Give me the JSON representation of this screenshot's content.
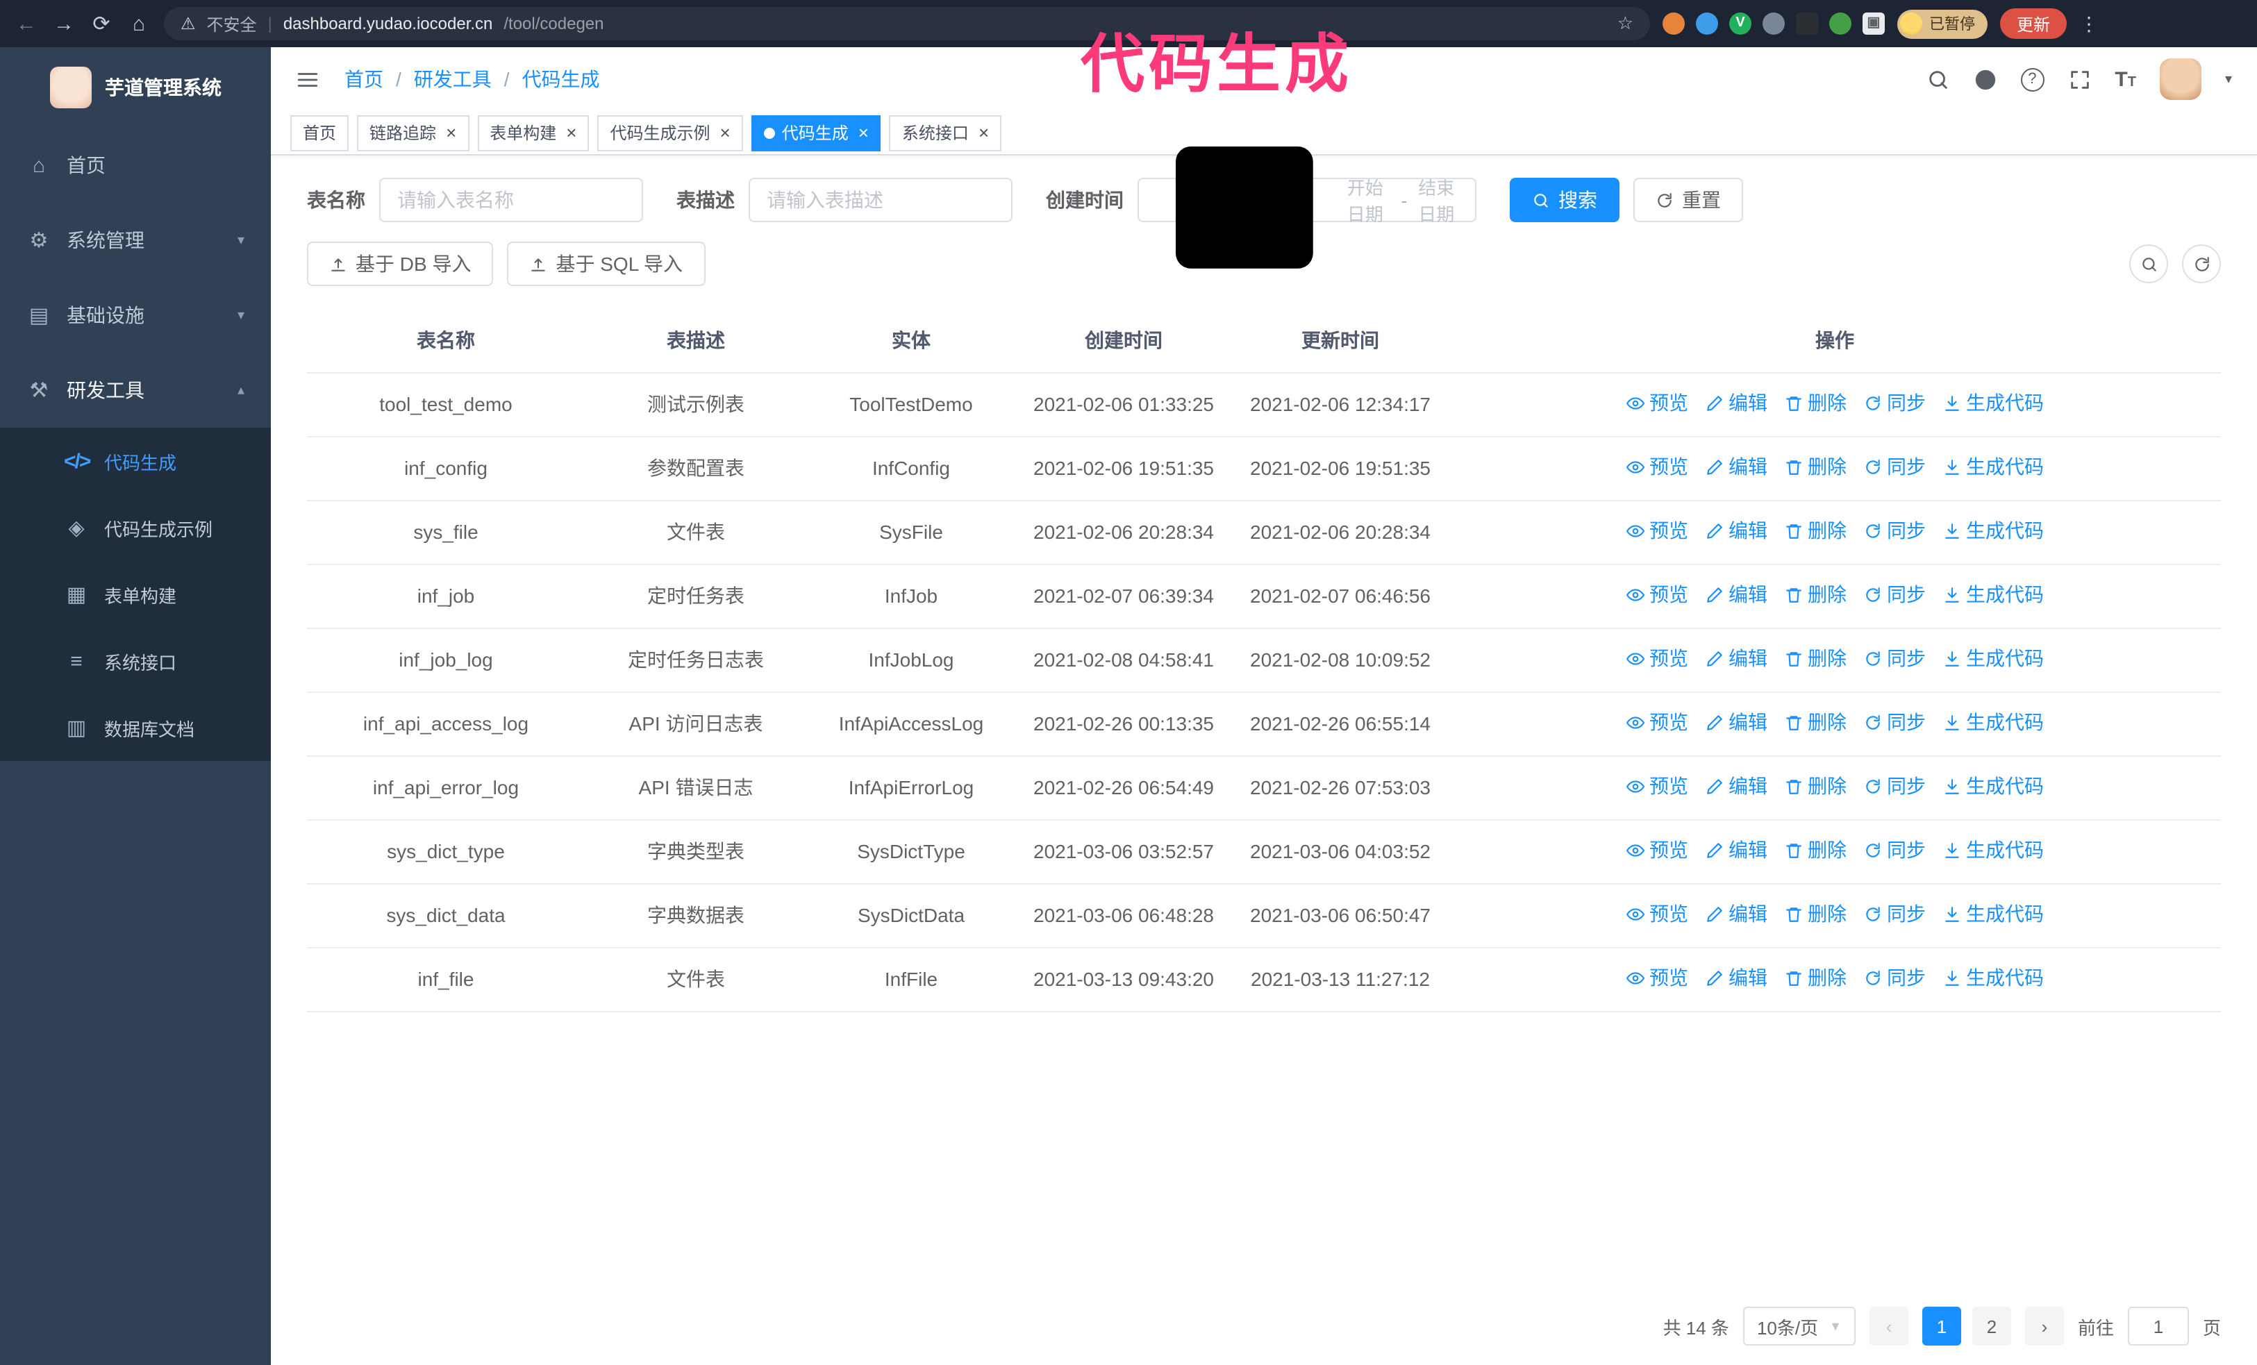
{
  "colors": {
    "accent": "#1890ff",
    "annotation": "#fb3a7a",
    "sidebar_bg": "#304156",
    "submenu_bg": "#1f2d3d",
    "update_button_bg": "#dd5144",
    "tag_active_bg": "#1890ff"
  },
  "annotation": {
    "text": "代码生成"
  },
  "browser": {
    "security_label": "不安全",
    "url_domain": "dashboard.yudao.iocoder.cn",
    "url_path": "/tool/codegen",
    "paused_badge": "已暂停",
    "update_button": "更新"
  },
  "sidebar": {
    "title": "芋道管理系统",
    "items": [
      {
        "label": "首页",
        "icon": "home-icon"
      },
      {
        "label": "系统管理",
        "icon": "gear-icon",
        "chevron": "down"
      },
      {
        "label": "基础设施",
        "icon": "infrastructure-icon",
        "chevron": "down"
      },
      {
        "label": "研发工具",
        "icon": "tools-icon",
        "chevron": "up",
        "expanded": true,
        "children": [
          {
            "label": "代码生成",
            "icon": "code-icon",
            "active": true
          },
          {
            "label": "代码生成示例",
            "icon": "example-icon"
          },
          {
            "label": "表单构建",
            "icon": "form-builder-icon"
          },
          {
            "label": "系统接口",
            "icon": "api-icon"
          },
          {
            "label": "数据库文档",
            "icon": "database-doc-icon"
          }
        ]
      }
    ]
  },
  "header": {
    "breadcrumb": [
      "首页",
      "研发工具",
      "代码生成"
    ]
  },
  "tags": [
    {
      "label": "首页",
      "closable": false,
      "active": false
    },
    {
      "label": "链路追踪",
      "closable": true,
      "active": false
    },
    {
      "label": "表单构建",
      "closable": true,
      "active": false
    },
    {
      "label": "代码生成示例",
      "closable": true,
      "active": false
    },
    {
      "label": "代码生成",
      "closable": true,
      "active": true
    },
    {
      "label": "系统接口",
      "closable": true,
      "active": false
    }
  ],
  "filters": {
    "table_name_label": "表名称",
    "table_name_placeholder": "请输入表名称",
    "table_desc_label": "表描述",
    "table_desc_placeholder": "请输入表描述",
    "create_time_label": "创建时间",
    "date_start_placeholder": "开始日期",
    "date_separator": "-",
    "date_end_placeholder": "结束日期",
    "search_button": "搜索",
    "reset_button": "重置"
  },
  "toolbar": {
    "import_db_button": "基于 DB 导入",
    "import_sql_button": "基于 SQL 导入"
  },
  "table": {
    "columns": [
      "表名称",
      "表描述",
      "实体",
      "创建时间",
      "更新时间",
      "操作"
    ],
    "ops": [
      {
        "name": "preview-link",
        "label": "预览",
        "icon": "eye-icon"
      },
      {
        "name": "edit-link",
        "label": "编辑",
        "icon": "edit-icon"
      },
      {
        "name": "delete-link",
        "label": "删除",
        "icon": "delete-icon"
      },
      {
        "name": "sync-link",
        "label": "同步",
        "icon": "sync-icon"
      },
      {
        "name": "generate-code-link",
        "label": "生成代码",
        "icon": "generate-icon"
      }
    ],
    "rows": [
      {
        "name": "tool_test_demo",
        "desc": "测试示例表",
        "entity": "ToolTestDemo",
        "created": "2021-02-06 01:33:25",
        "updated": "2021-02-06 12:34:17"
      },
      {
        "name": "inf_config",
        "desc": "参数配置表",
        "entity": "InfConfig",
        "created": "2021-02-06 19:51:35",
        "updated": "2021-02-06 19:51:35"
      },
      {
        "name": "sys_file",
        "desc": "文件表",
        "entity": "SysFile",
        "created": "2021-02-06 20:28:34",
        "updated": "2021-02-06 20:28:34"
      },
      {
        "name": "inf_job",
        "desc": "定时任务表",
        "entity": "InfJob",
        "created": "2021-02-07 06:39:34",
        "updated": "2021-02-07 06:46:56"
      },
      {
        "name": "inf_job_log",
        "desc": "定时任务日志表",
        "entity": "InfJobLog",
        "created": "2021-02-08 04:58:41",
        "updated": "2021-02-08 10:09:52"
      },
      {
        "name": "inf_api_access_log",
        "desc": "API 访问日志表",
        "entity": "InfApiAccessLog",
        "created": "2021-02-26 00:13:35",
        "updated": "2021-02-26 06:55:14"
      },
      {
        "name": "inf_api_error_log",
        "desc": "API 错误日志",
        "entity": "InfApiErrorLog",
        "created": "2021-02-26 06:54:49",
        "updated": "2021-02-26 07:53:03"
      },
      {
        "name": "sys_dict_type",
        "desc": "字典类型表",
        "entity": "SysDictType",
        "created": "2021-03-06 03:52:57",
        "updated": "2021-03-06 04:03:52"
      },
      {
        "name": "sys_dict_data",
        "desc": "字典数据表",
        "entity": "SysDictData",
        "created": "2021-03-06 06:48:28",
        "updated": "2021-03-06 06:50:47"
      },
      {
        "name": "inf_file",
        "desc": "文件表",
        "entity": "InfFile",
        "created": "2021-03-13 09:43:20",
        "updated": "2021-03-13 11:27:12"
      }
    ]
  },
  "pagination": {
    "total": "共 14 条",
    "page_size": "10条/页",
    "pages": [
      "1",
      "2"
    ],
    "active_page": "1",
    "goto_label": "前往",
    "goto_value": "1",
    "goto_unit": "页"
  }
}
